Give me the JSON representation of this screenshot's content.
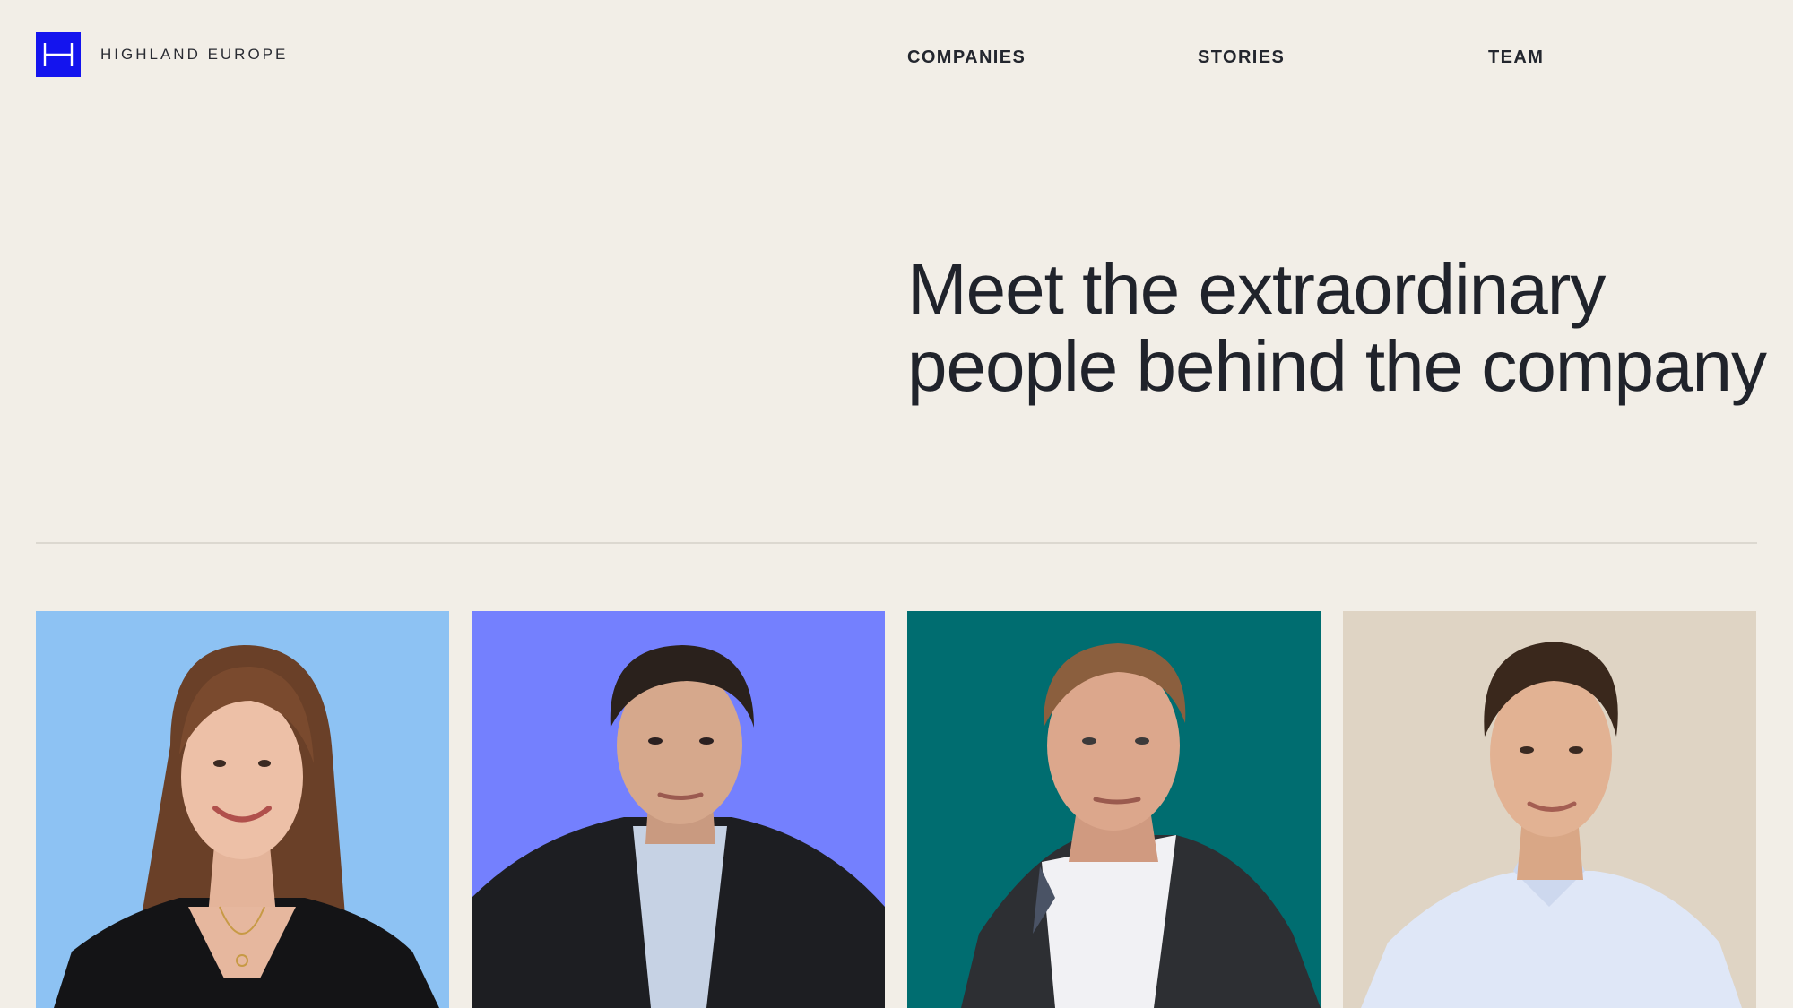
{
  "header": {
    "logo_text": "HIGHLAND EUROPE",
    "logo_color": "#1414ee",
    "nav": [
      "COMPANIES",
      "STORIES",
      "TEAM"
    ]
  },
  "hero": {
    "title": "Meet the extraordinary people behind the company"
  },
  "team": {
    "cards": [
      {
        "background": "#8dc2f3",
        "icon": "portrait-woman-long-hair"
      },
      {
        "background": "#7480fe",
        "icon": "portrait-man-dark-curly-hair"
      },
      {
        "background": "#006d70",
        "icon": "portrait-man-grey-suit"
      },
      {
        "background": "#dfd4c4",
        "icon": "portrait-man-light-shirt"
      }
    ]
  }
}
